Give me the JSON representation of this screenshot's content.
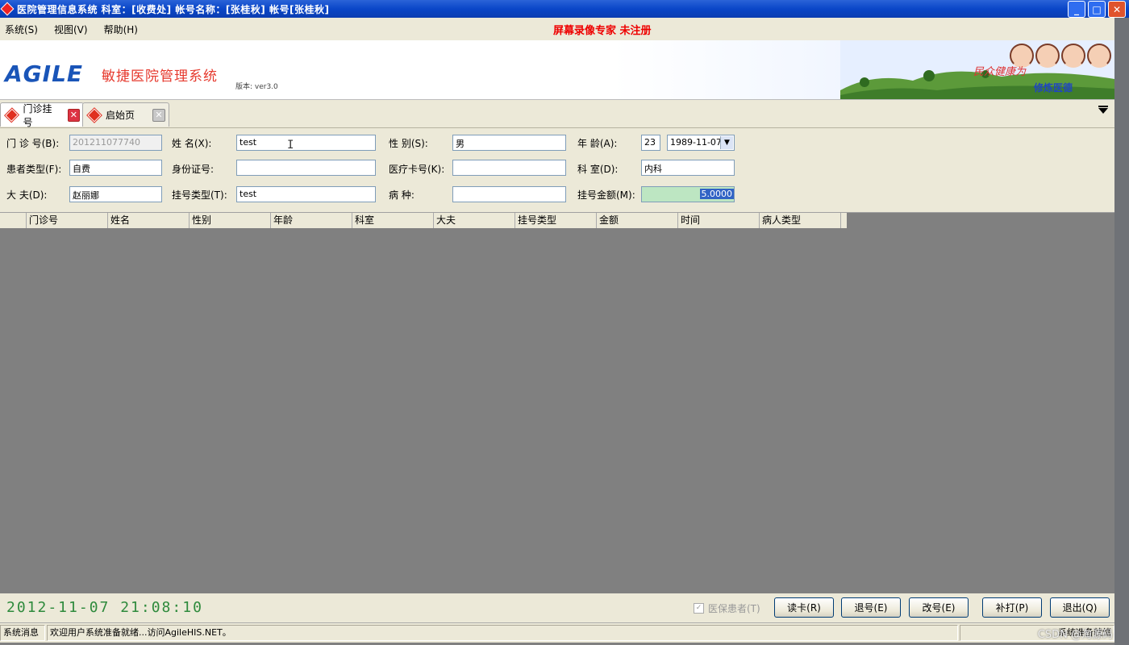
{
  "window": {
    "title": "医院管理信息系统 科室：[收费处] 帐号名称：[张桂秋] 帐号[张桂秋]",
    "minimize": "_",
    "maximize": "□",
    "close": "✕"
  },
  "menubar": {
    "items": [
      "系统(S)",
      "视图(V)",
      "帮助(H)"
    ],
    "notice": "屏幕录像专家 未注册"
  },
  "banner": {
    "logo": "AGILE",
    "system_name": "敏捷医院管理系统",
    "version": "版本: ver3.0",
    "slogan": "民众健康为",
    "slogan2": "修炼医德"
  },
  "tabs": [
    {
      "label": "门诊挂号",
      "active": true
    },
    {
      "label": "启始页",
      "active": false
    }
  ],
  "form": {
    "clinic_no_label": "门 诊 号(B):",
    "clinic_no_value": "201211077740",
    "name_label": "姓    名(X):",
    "name_value": "test",
    "gender_label": "性    别(S):",
    "gender_value": "男",
    "age_label": "年    龄(A):",
    "age_value": "23",
    "birth_value": "1989-11-07",
    "patient_type_label": "患者类型(F):",
    "patient_type_value": "自费",
    "id_card_label": "身份证号:",
    "id_card_value": "",
    "medical_card_label": "医疗卡号(K):",
    "medical_card_value": "",
    "dept_label": "科    室(D):",
    "dept_value": "内科",
    "doctor_label": "大    夫(D):",
    "doctor_value": "赵丽娜",
    "reg_type_label": "挂号类型(T):",
    "reg_type_value": "test",
    "disease_label": "病    种:",
    "disease_value": "",
    "amount_label": "挂号金额(M):",
    "amount_value": "5.0000"
  },
  "grid": {
    "columns": [
      "门诊号",
      "姓名",
      "性别",
      "年龄",
      "科室",
      "大夫",
      "挂号类型",
      "金额",
      "时间",
      "病人类型"
    ]
  },
  "bottom": {
    "clock": "2012-11-07 21:08:10",
    "insurance_checkbox": "医保患者(T)",
    "buttons": [
      "读卡(R)",
      "退号(E)",
      "改号(E)",
      "补打(P)",
      "退出(Q)"
    ]
  },
  "statusbar": {
    "label": "系统消息",
    "message": "欢迎用户系统准备就绪...访问AgileHIS.NET。",
    "right": "系统准备就绪"
  },
  "watermark": "CSDN @淘源码"
}
